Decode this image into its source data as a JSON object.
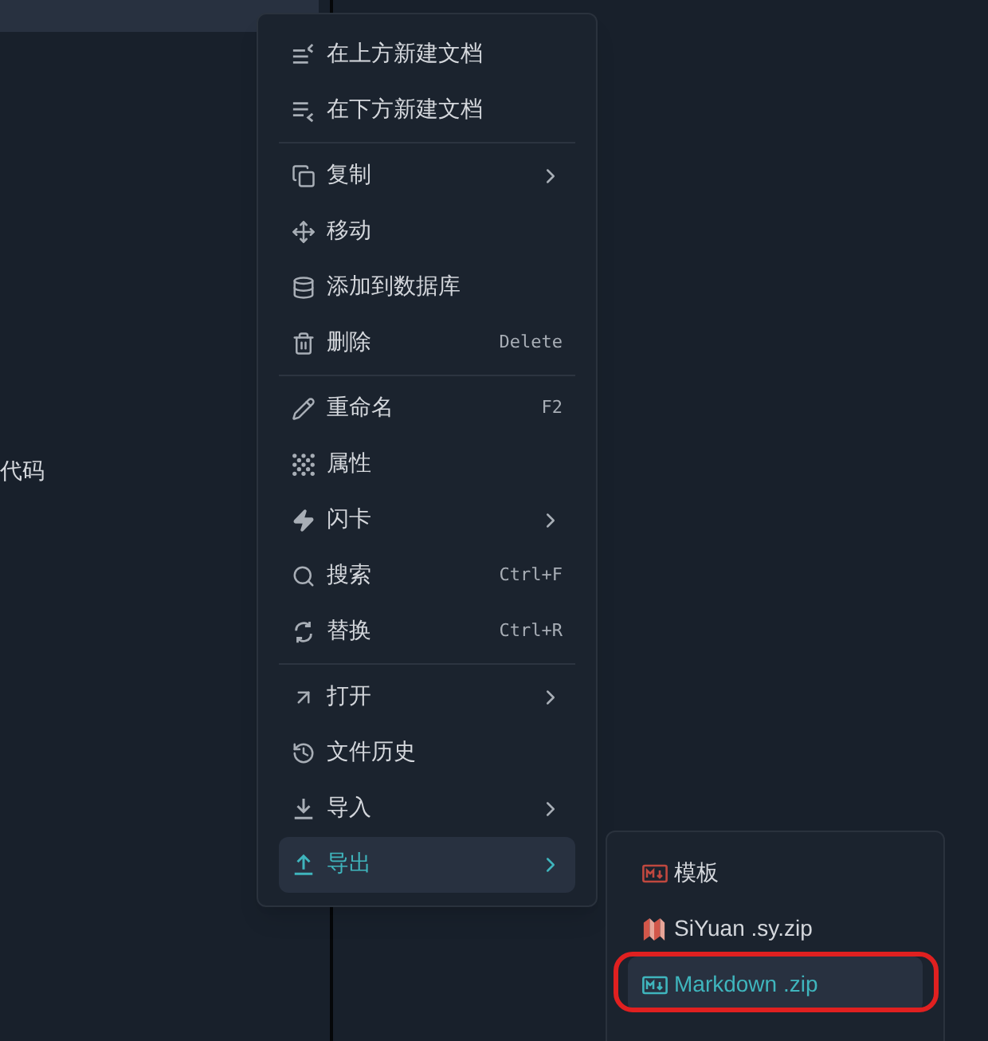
{
  "background": {
    "text": "代码"
  },
  "menu": {
    "groups": [
      [
        {
          "label": "在上方新建文档",
          "submenu": false,
          "selected": false
        },
        {
          "label": "在下方新建文档",
          "submenu": false,
          "selected": false
        }
      ],
      [
        {
          "label": "复制",
          "submenu": true,
          "selected": false
        },
        {
          "label": "移动",
          "submenu": false,
          "selected": false
        },
        {
          "label": "添加到数据库",
          "submenu": false,
          "selected": false
        },
        {
          "label": "删除",
          "shortcut": "Delete",
          "submenu": false,
          "selected": false
        }
      ],
      [
        {
          "label": "重命名",
          "shortcut": "F2",
          "submenu": false,
          "selected": false
        },
        {
          "label": "属性",
          "submenu": false,
          "selected": false
        },
        {
          "label": "闪卡",
          "submenu": true,
          "selected": false
        },
        {
          "label": "搜索",
          "shortcut": "Ctrl+F",
          "submenu": false,
          "selected": false
        },
        {
          "label": "替换",
          "shortcut": "Ctrl+R",
          "submenu": false,
          "selected": false
        }
      ],
      [
        {
          "label": "打开",
          "submenu": true,
          "selected": false
        },
        {
          "label": "文件历史",
          "submenu": false,
          "selected": false
        },
        {
          "label": "导入",
          "submenu": true,
          "selected": false
        },
        {
          "label": "导出",
          "submenu": true,
          "selected": true
        }
      ]
    ]
  },
  "submenu": {
    "items": [
      {
        "label": "模板",
        "selected": false
      },
      {
        "label": "SiYuan .sy.zip",
        "selected": false
      },
      {
        "label": "Markdown .zip",
        "selected": true,
        "highlighted": true
      }
    ]
  }
}
